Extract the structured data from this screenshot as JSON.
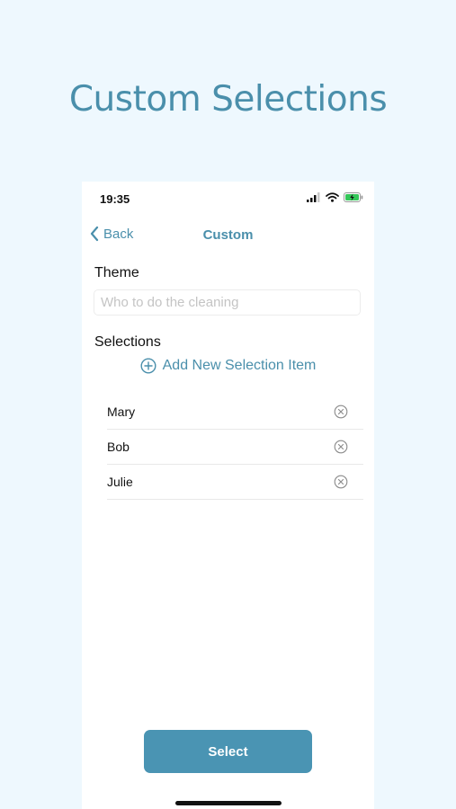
{
  "headline": "Custom Selections",
  "status_bar": {
    "time": "19:35",
    "signal_icon": "signal-bars-icon",
    "wifi_icon": "wifi-icon",
    "battery_icon": "battery-charging-icon"
  },
  "nav": {
    "back_label": "Back",
    "back_icon": "chevron-left-icon",
    "title": "Custom"
  },
  "theme": {
    "label": "Theme",
    "value": "",
    "placeholder": "Who to do the cleaning"
  },
  "selections": {
    "label": "Selections",
    "add_label": "Add New Selection Item",
    "add_icon": "plus-circle-icon",
    "remove_icon": "x-circle-icon",
    "items": [
      {
        "name": "Mary"
      },
      {
        "name": "Bob"
      },
      {
        "name": "Julie"
      }
    ]
  },
  "select_button_label": "Select",
  "colors": {
    "background": "#eef8fe",
    "accent": "#4a8fab",
    "button": "#4a94b3",
    "battery": "#34c759"
  }
}
